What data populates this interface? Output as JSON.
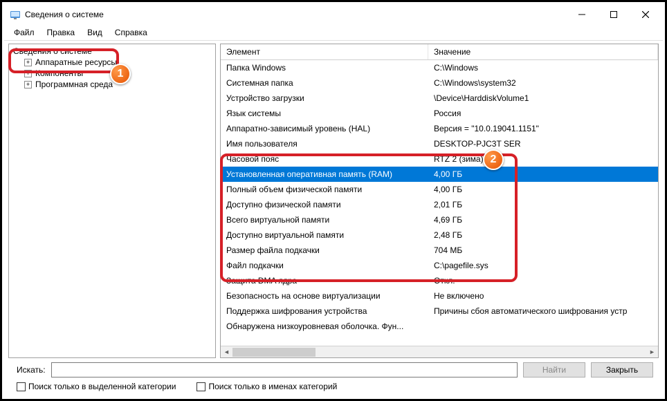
{
  "window": {
    "title": "Сведения о системе"
  },
  "menu": {
    "file": "Файл",
    "edit": "Правка",
    "view": "Вид",
    "help": "Справка"
  },
  "tree": {
    "root": "Сведения о системе",
    "items": [
      {
        "label": "Аппаратные ресурсы"
      },
      {
        "label": "Компоненты"
      },
      {
        "label": "Программная среда"
      }
    ]
  },
  "table": {
    "col_element": "Элемент",
    "col_value": "Значение",
    "rows": [
      {
        "el": "Папка Windows",
        "val": "C:\\Windows"
      },
      {
        "el": "Системная папка",
        "val": "C:\\Windows\\system32"
      },
      {
        "el": "Устройство загрузки",
        "val": "\\Device\\HarddiskVolume1"
      },
      {
        "el": "Язык системы",
        "val": "Россия"
      },
      {
        "el": "Аппаратно-зависимый уровень (HAL)",
        "val": "Версия = \"10.0.19041.1151\""
      },
      {
        "el": "Имя пользователя",
        "val": "DESKTOP-PJC3T        SER"
      },
      {
        "el": "Часовой пояс",
        "val": "RTZ 2 (зима)"
      },
      {
        "el": "Установленная оперативная память (RAM)",
        "val": "4,00 ГБ",
        "selected": true
      },
      {
        "el": "Полный объем физической памяти",
        "val": "4,00 ГБ"
      },
      {
        "el": "Доступно физической памяти",
        "val": "2,01 ГБ"
      },
      {
        "el": "Всего виртуальной памяти",
        "val": "4,69 ГБ"
      },
      {
        "el": "Доступно виртуальной памяти",
        "val": "2,48 ГБ"
      },
      {
        "el": "Размер файла подкачки",
        "val": "704 МБ"
      },
      {
        "el": "Файл подкачки",
        "val": "C:\\pagefile.sys"
      },
      {
        "el": "Защита DMA ядра",
        "val": "Откл."
      },
      {
        "el": "Безопасность на основе виртуализации",
        "val": "Не включено"
      },
      {
        "el": "Поддержка шифрования устройства",
        "val": "Причины сбоя автоматического шифрования устр"
      },
      {
        "el": "Обнаружена низкоуровневая оболочка. Фун...",
        "val": ""
      }
    ]
  },
  "search": {
    "label": "Искать:",
    "find": "Найти",
    "close": "Закрыть",
    "opt_category": "Поиск только в выделенной категории",
    "opt_names": "Поиск только в именах категорий"
  },
  "badges": {
    "one": "1",
    "two": "2"
  }
}
